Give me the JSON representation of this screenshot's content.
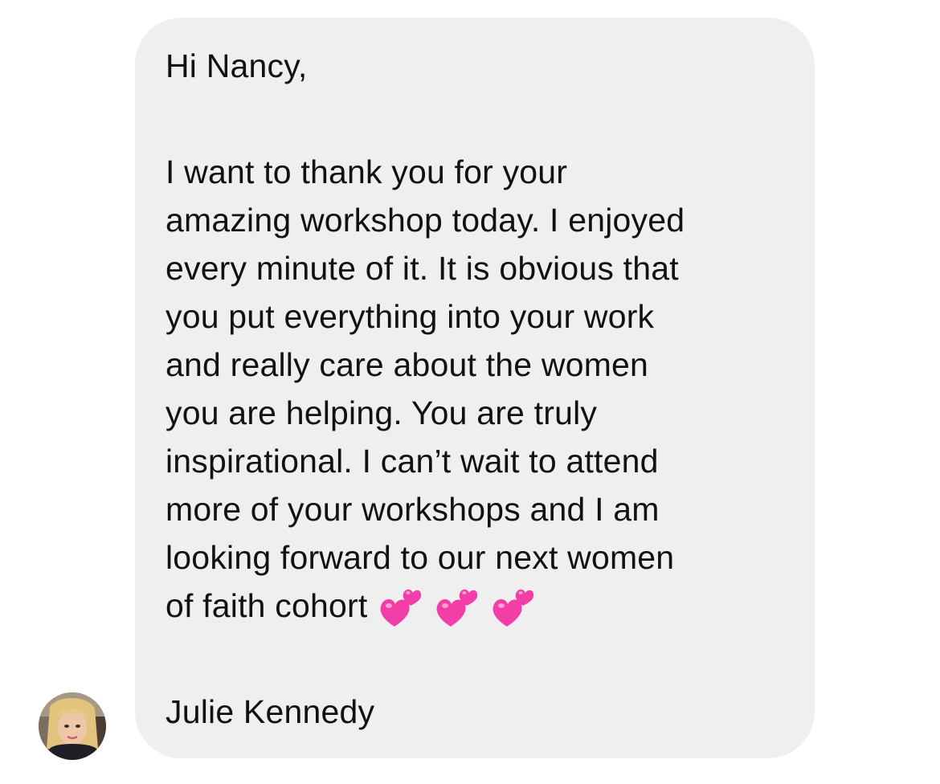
{
  "message": {
    "greeting": "Hi Nancy,",
    "lines": [
      "I want to thank you for your",
      "amazing workshop today. I enjoyed",
      "every minute of it. It is obvious that",
      "you put everything into your work",
      "and really care about the women",
      "you are helping. You are truly",
      "inspirational. I can’t wait to attend",
      "more of your workshops and I am",
      "looking forward to our next women"
    ],
    "last_line": "of faith cohort",
    "emoji": [
      "two-hearts-icon",
      "two-hearts-icon",
      "two-hearts-icon"
    ],
    "signature": "Julie Kennedy"
  },
  "colors": {
    "bubble_background": "#efefef",
    "text": "#111111",
    "heart_pink": "#f23fa8"
  },
  "sender": {
    "avatar": "avatar-photo"
  }
}
